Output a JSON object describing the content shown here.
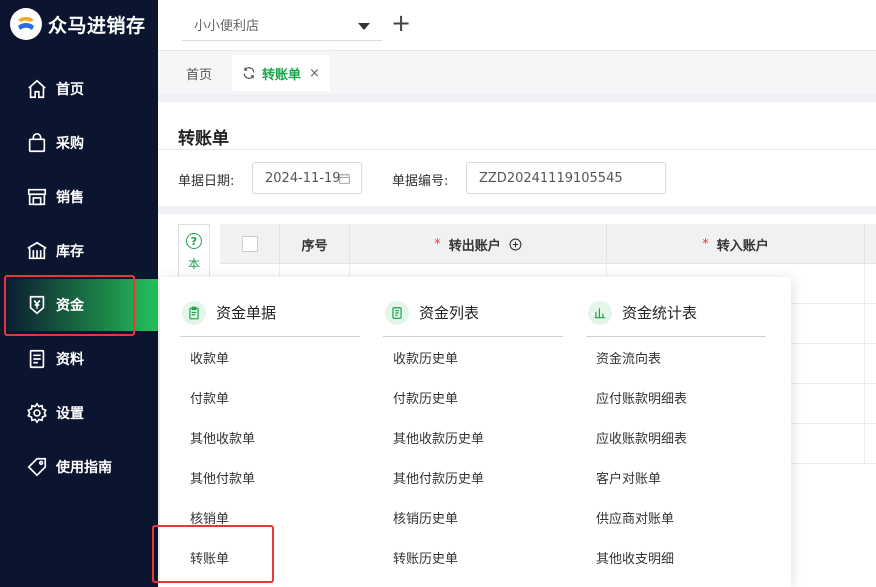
{
  "app": {
    "logo_text": "众马进销存"
  },
  "sidebar": {
    "items": [
      {
        "label": "首页",
        "icon": "home-icon"
      },
      {
        "label": "采购",
        "icon": "shopping-bag-icon"
      },
      {
        "label": "销售",
        "icon": "store-icon"
      },
      {
        "label": "库存",
        "icon": "warehouse-icon"
      },
      {
        "label": "资金",
        "icon": "yen-shield-icon"
      },
      {
        "label": "资料",
        "icon": "document-icon"
      },
      {
        "label": "设置",
        "icon": "gear-icon"
      },
      {
        "label": "使用指南",
        "icon": "tag-icon"
      }
    ],
    "active_index": 4
  },
  "topbar": {
    "store_name": "小小便利店",
    "add_label": "+"
  },
  "tabs": [
    {
      "label": "首页",
      "active": false
    },
    {
      "label": "转账单",
      "active": true,
      "close": "×"
    }
  ],
  "page": {
    "title": "转账单",
    "date_label": "单据日期:",
    "date_value": "2024-11-19",
    "number_label": "单据编号:",
    "number_value": "ZZD20241119105545",
    "help_text": "本"
  },
  "grid": {
    "headers": [
      {
        "label": "",
        "required": false
      },
      {
        "label": "序号",
        "required": false
      },
      {
        "label": "转出账户",
        "required": true,
        "plus_icon": true
      },
      {
        "label": "转入账户",
        "required": true
      }
    ],
    "required_mark": "*",
    "row_count": 5
  },
  "menu": {
    "columns": [
      {
        "title": "资金单据",
        "icon": "clipboard-icon",
        "items": [
          "收款单",
          "付款单",
          "其他收款单",
          "其他付款单",
          "核销单",
          "转账单"
        ]
      },
      {
        "title": "资金列表",
        "icon": "list-icon",
        "items": [
          "收款历史单",
          "付款历史单",
          "其他收款历史单",
          "其他付款历史单",
          "核销历史单",
          "转账历史单"
        ]
      },
      {
        "title": "资金统计表",
        "icon": "bar-chart-icon",
        "items": [
          "资金流向表",
          "应付账款明细表",
          "应收账款明细表",
          "客户对账单",
          "供应商对账单",
          "其他收支明细"
        ]
      }
    ]
  },
  "colors": {
    "accent": "#1aa34a",
    "sidebar_bg": "#0b1530",
    "highlight_border": "#e53935"
  }
}
